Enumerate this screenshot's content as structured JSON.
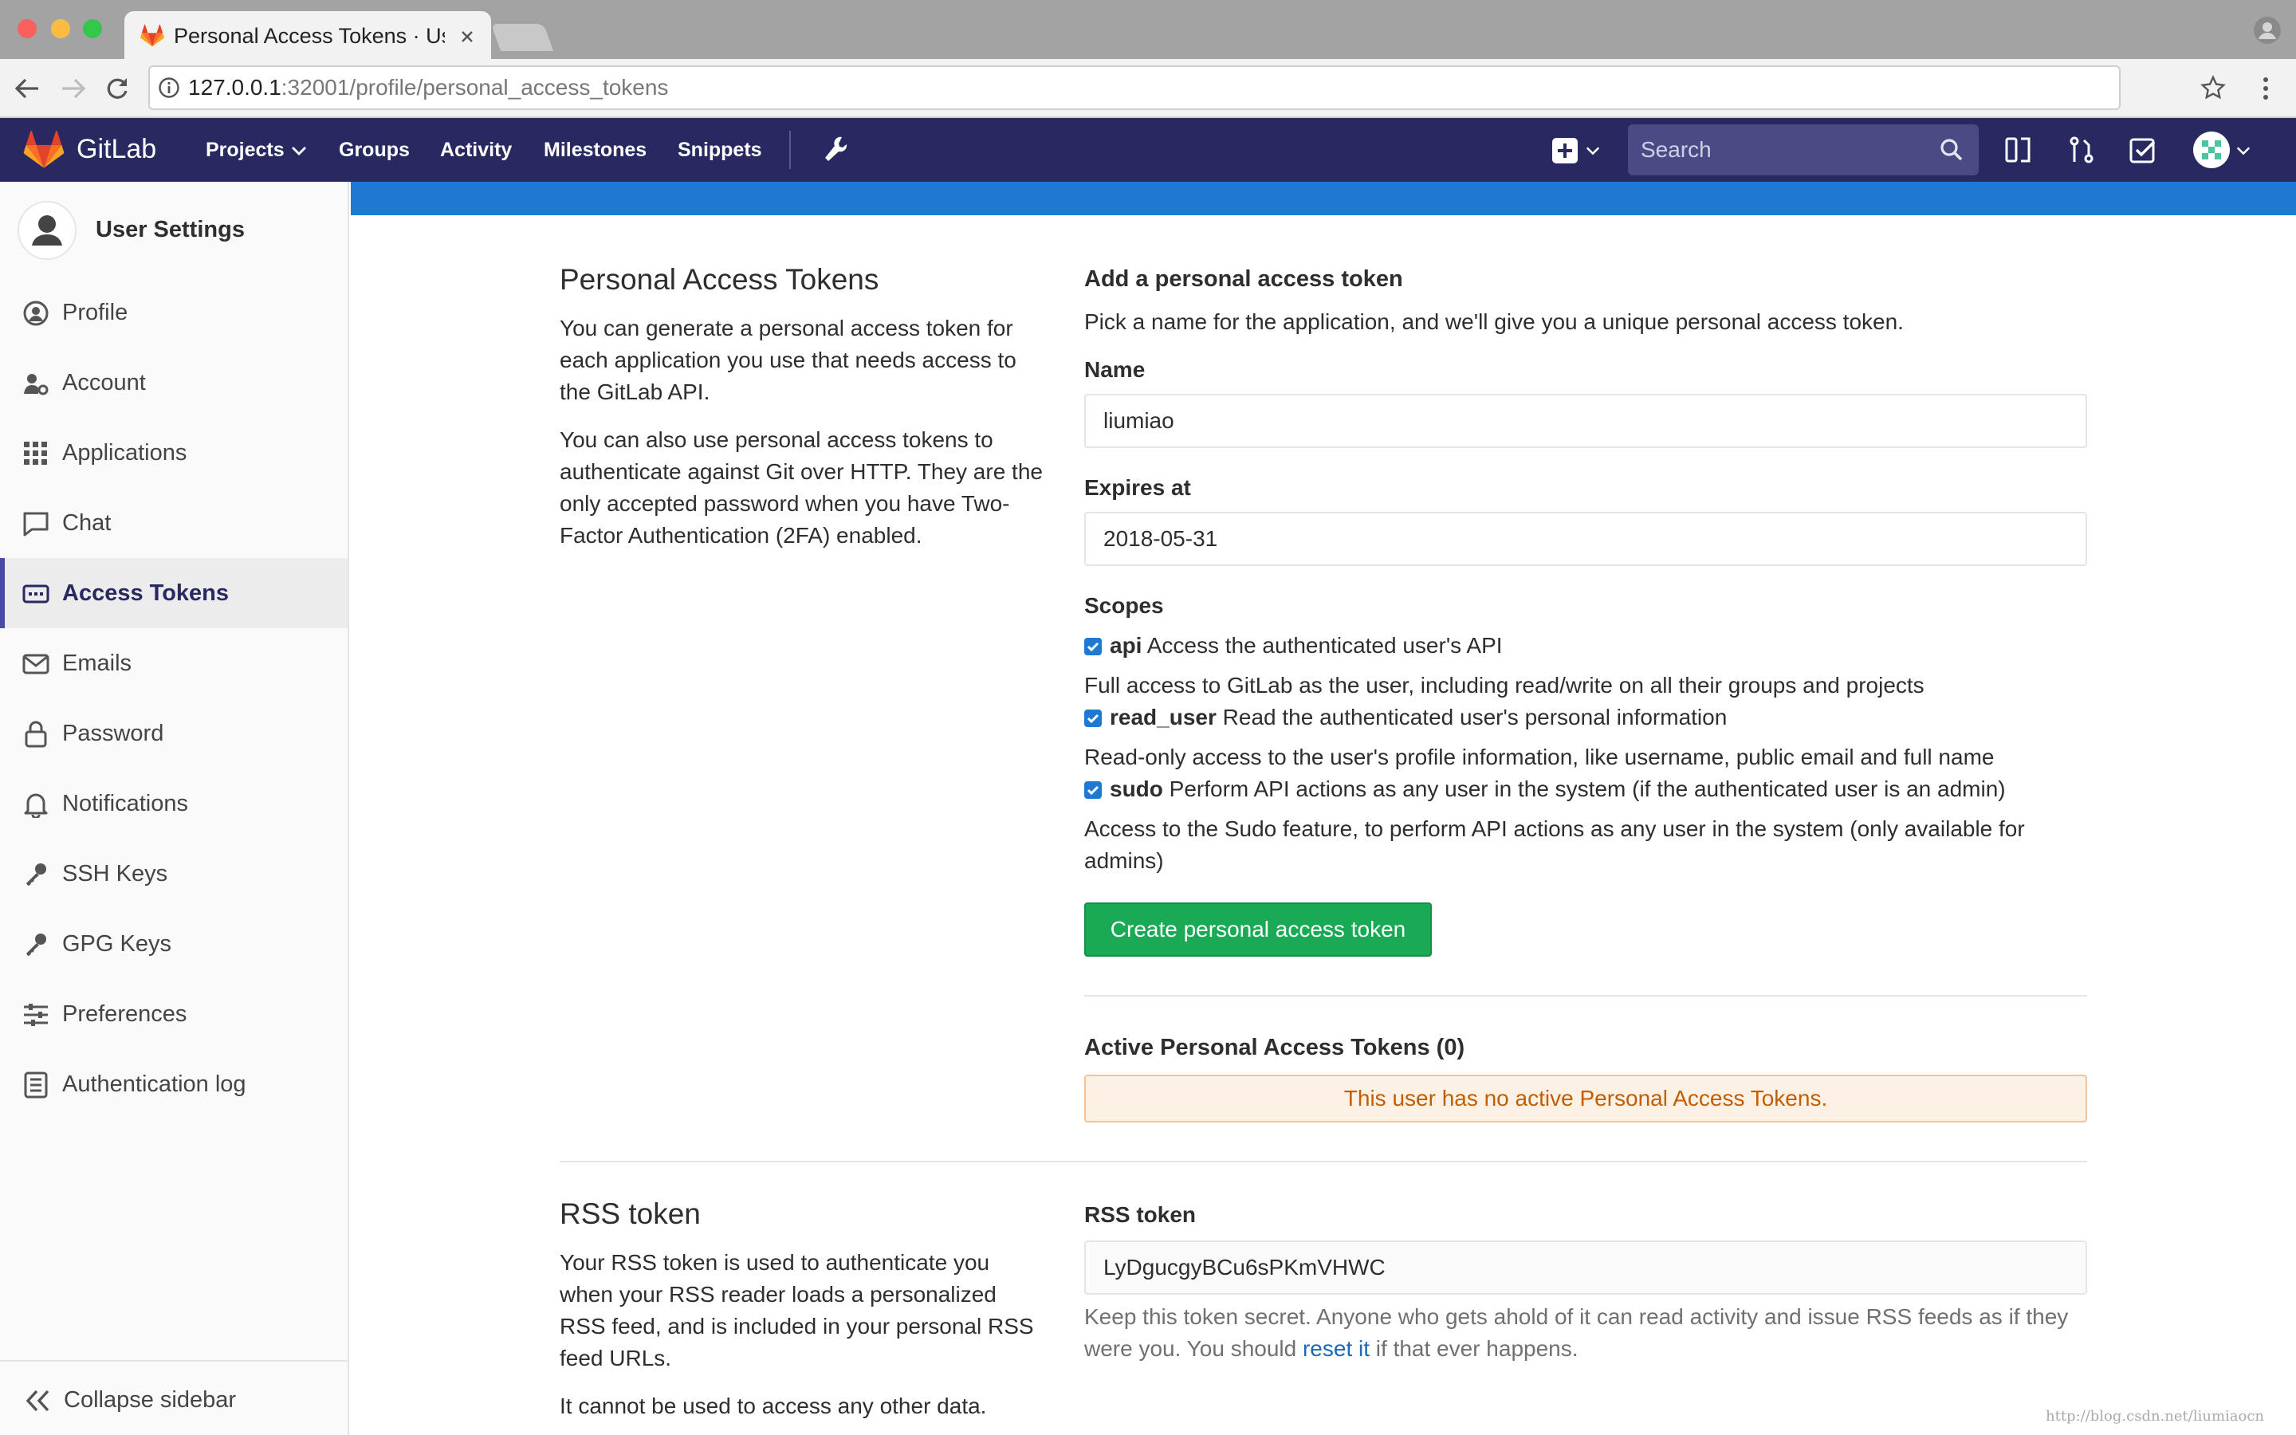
{
  "browser": {
    "tab_title": "Personal Access Tokens · User",
    "url_host": "127.0.0.1",
    "url_path": ":32001/profile/personal_access_tokens"
  },
  "header": {
    "brand": "GitLab",
    "nav": [
      "Projects",
      "Groups",
      "Activity",
      "Milestones",
      "Snippets"
    ],
    "search_placeholder": "Search"
  },
  "sidebar": {
    "title": "User Settings",
    "items": [
      {
        "label": "Profile",
        "icon": "profile-icon"
      },
      {
        "label": "Account",
        "icon": "account-icon"
      },
      {
        "label": "Applications",
        "icon": "applications-icon"
      },
      {
        "label": "Chat",
        "icon": "chat-icon"
      },
      {
        "label": "Access Tokens",
        "icon": "access-tokens-icon",
        "active": true
      },
      {
        "label": "Emails",
        "icon": "emails-icon"
      },
      {
        "label": "Password",
        "icon": "lock-icon"
      },
      {
        "label": "Notifications",
        "icon": "bell-icon"
      },
      {
        "label": "SSH Keys",
        "icon": "key-icon"
      },
      {
        "label": "GPG Keys",
        "icon": "key-icon"
      },
      {
        "label": "Preferences",
        "icon": "sliders-icon"
      },
      {
        "label": "Authentication log",
        "icon": "log-icon"
      }
    ],
    "collapse_label": "Collapse sidebar"
  },
  "pat": {
    "title": "Personal Access Tokens",
    "desc1": "You can generate a personal access token for each application you use that needs access to the GitLab API.",
    "desc2": "You can also use personal access tokens to authenticate against Git over HTTP. They are the only accepted password when you have Two-Factor Authentication (2FA) enabled.",
    "form_title": "Add a personal access token",
    "form_desc": "Pick a name for the application, and we'll give you a unique personal access token.",
    "name_label": "Name",
    "name_value": "liumiao",
    "expires_label": "Expires at",
    "expires_value": "2018-05-31",
    "scopes_label": "Scopes",
    "scopes": [
      {
        "name": "api",
        "summary": "Access the authenticated user's API",
        "detail": "Full access to GitLab as the user, including read/write on all their groups and projects",
        "checked": true
      },
      {
        "name": "read_user",
        "summary": "Read the authenticated user's personal information",
        "detail": "Read-only access to the user's profile information, like username, public email and full name",
        "checked": true
      },
      {
        "name": "sudo",
        "summary": "Perform API actions as any user in the system (if the authenticated user is an admin)",
        "detail": "Access to the Sudo feature, to perform API actions as any user in the system (only available for admins)",
        "checked": true
      }
    ],
    "create_button": "Create personal access token",
    "active_title": "Active Personal Access Tokens (0)",
    "no_tokens": "This user has no active Personal Access Tokens."
  },
  "rss": {
    "title": "RSS token",
    "desc1": "Your RSS token is used to authenticate you when your RSS reader loads a personalized RSS feed, and is included in your personal RSS feed URLs.",
    "desc2": "It cannot be used to access any other data.",
    "label": "RSS token",
    "value": "LyDgucgyBCu6sPKmVHWC",
    "help_before": "Keep this token secret. Anyone who gets ahold of it can read activity and issue RSS feeds as if they were you. You should ",
    "help_link": "reset it",
    "help_after": " if that ever happens."
  },
  "watermark": "http://blog.csdn.net/liumiaocn",
  "colors": {
    "header": "#292961",
    "accent_blue": "#1f78d1",
    "success": "#1aaa55",
    "warning_bg": "#fdf1e5",
    "warning_text": "#c25e00"
  }
}
